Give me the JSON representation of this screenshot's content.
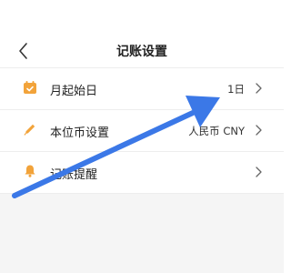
{
  "header": {
    "title": "记账设置",
    "back_icon": "chevron-left-icon"
  },
  "settings": {
    "items": [
      {
        "label": "月起始日",
        "value": "1日",
        "icon": "calendar-icon",
        "icon_color": "#F2A33A"
      },
      {
        "label": "本位币设置",
        "value": "人民币 CNY",
        "icon": "pencil-icon",
        "icon_color": "#F2A33A"
      },
      {
        "label": "记账提醒",
        "value": "",
        "icon": "bell-icon",
        "icon_color": "#F2A33A"
      }
    ]
  },
  "colors": {
    "accent": "#F2A33A",
    "annotation_arrow": "#3B78E7",
    "background": "#F5F5F5"
  }
}
